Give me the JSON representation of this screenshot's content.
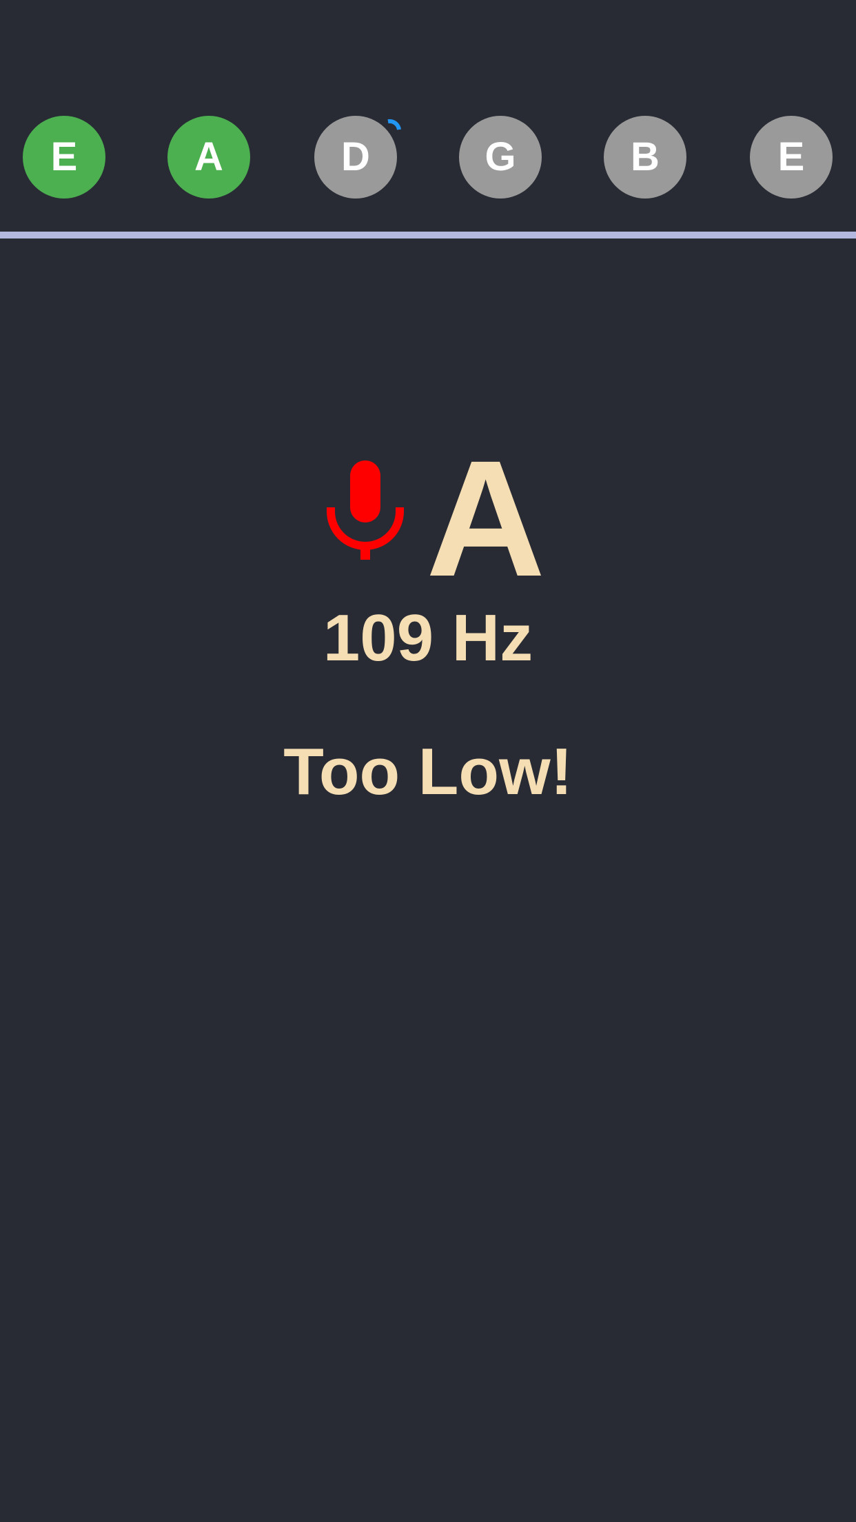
{
  "strings": [
    {
      "label": "E",
      "state": "tuned"
    },
    {
      "label": "A",
      "state": "tuned"
    },
    {
      "label": "D",
      "state": "pending"
    },
    {
      "label": "G",
      "state": "pending"
    },
    {
      "label": "B",
      "state": "pending"
    },
    {
      "label": "E",
      "state": "pending"
    }
  ],
  "colors": {
    "background": "#282b34",
    "tuned": "#4caf50",
    "pending": "#9a9a9a",
    "divider": "#b3b8de",
    "text": "#f5deb3",
    "mic": "#ff0000",
    "spinner": "#2196f3"
  },
  "icons": {
    "mic": "microphone-icon",
    "spinner": "loading-spinner-icon"
  },
  "detected": {
    "note": "A",
    "frequency": "109 Hz",
    "status": "Too Low!"
  }
}
